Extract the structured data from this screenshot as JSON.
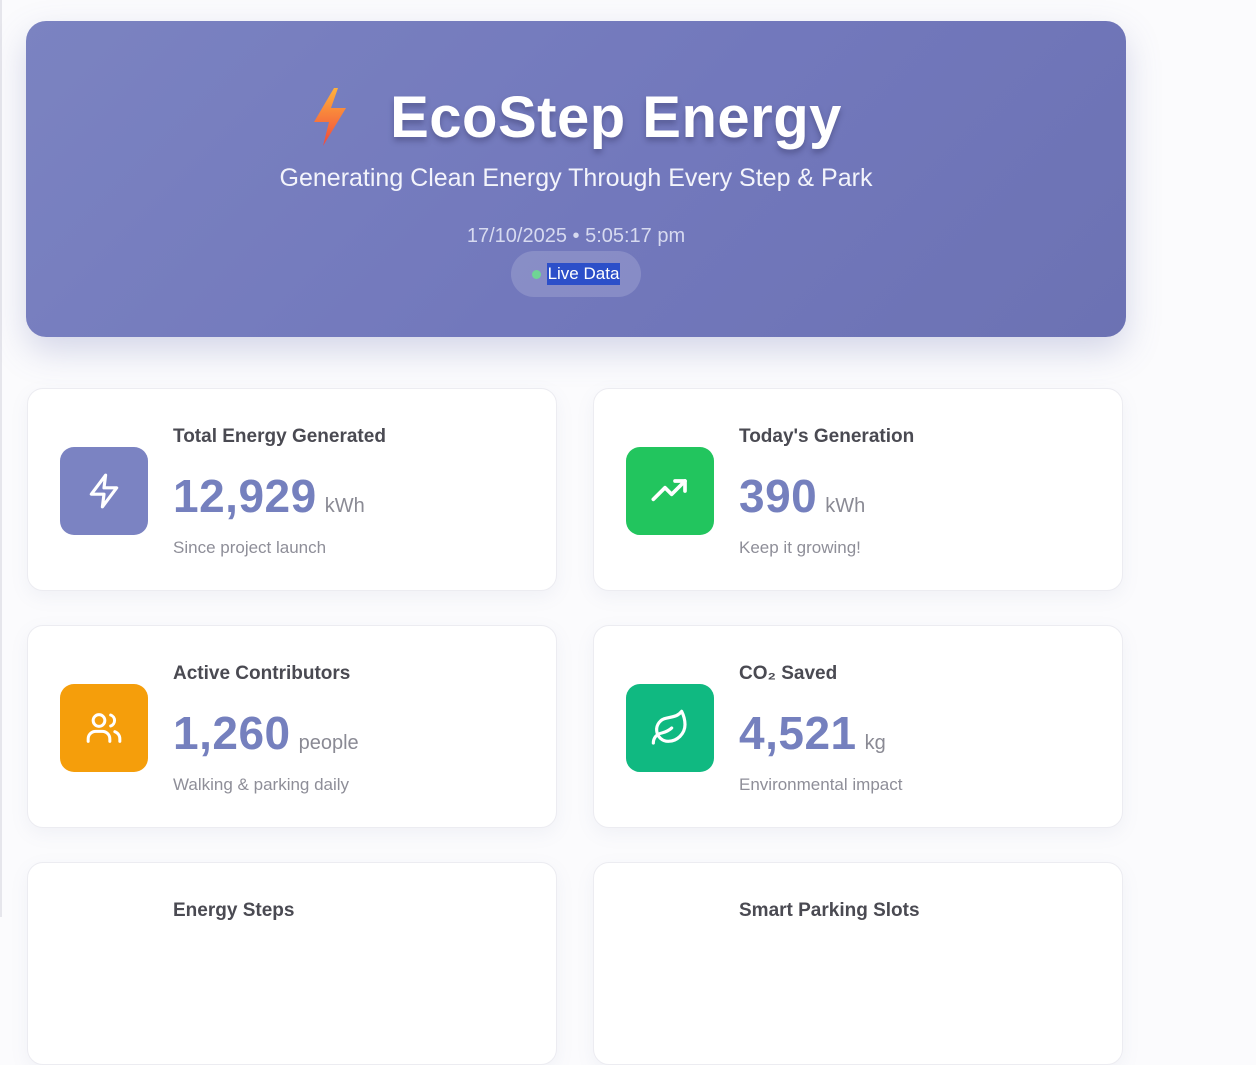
{
  "header": {
    "title": "EcoStep Energy",
    "subtitle": "Generating Clean Energy Through Every Step & Park",
    "datetime": "17/10/2025 • 5:05:17 pm",
    "live_label": "Live Data",
    "icon": "lightning-bolt-icon"
  },
  "stats": [
    {
      "label": "Total Energy Generated",
      "value": "12,929",
      "unit": "kWh",
      "sub": "Since project launch",
      "icon": "bolt-icon",
      "color": "#7b83c2"
    },
    {
      "label": "Today's Generation",
      "value": "390",
      "unit": "kWh",
      "sub": "Keep it growing!",
      "icon": "trending-up-icon",
      "color": "#22c55e"
    },
    {
      "label": "Active Contributors",
      "value": "1,260",
      "unit": "people",
      "sub": "Walking & parking daily",
      "icon": "users-icon",
      "color": "#f59e0b"
    },
    {
      "label": "CO₂ Saved",
      "value": "4,521",
      "unit": "kg",
      "sub": "Environmental impact",
      "icon": "leaf-icon",
      "color": "#10b981"
    },
    {
      "label": "Energy Steps"
    },
    {
      "label": "Smart Parking Slots"
    }
  ]
}
